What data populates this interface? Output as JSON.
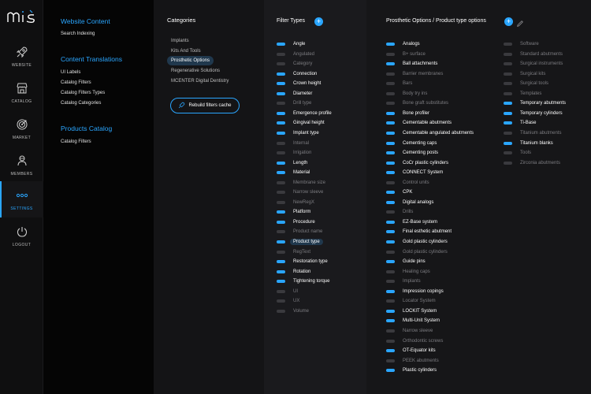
{
  "app": {
    "logo_text": "MIS"
  },
  "nav": [
    {
      "key": "website",
      "label": "WEBSITE",
      "icon": "rocket-icon",
      "active": false
    },
    {
      "key": "catalog",
      "label": "CATALOG",
      "icon": "store-icon",
      "active": false
    },
    {
      "key": "market",
      "label": "MARKET",
      "icon": "target-icon",
      "active": false
    },
    {
      "key": "members",
      "label": "MEMBERS",
      "icon": "members-icon",
      "active": false
    },
    {
      "key": "settings",
      "label": "SETTINGS",
      "icon": "dots-icon",
      "active": true
    },
    {
      "key": "logout",
      "label": "LOGOUT",
      "icon": "power-icon",
      "active": false
    }
  ],
  "content_menu": {
    "website_content": {
      "title": "Website Content",
      "items": [
        "Search Indexing"
      ]
    },
    "content_translations": {
      "title": "Content Translations",
      "items": [
        "UI Labels",
        "Catalog Filters",
        "Catalog Filters Types",
        "Catalog Categories"
      ]
    },
    "products_catalog": {
      "title": "Products Catalog",
      "items": [
        "Catalog Filters"
      ]
    }
  },
  "categories": {
    "title": "Categories",
    "items": [
      "Implants",
      "Kits And Tools",
      "Prosthetic Options",
      "Regenerative Solutions",
      "MCENTER Digital Dentistry"
    ],
    "active_index": 2,
    "rebuild_button": "Rebuild filters cache"
  },
  "filter_types": {
    "title": "Filter Types",
    "items": [
      {
        "label": "Angle",
        "on": true
      },
      {
        "label": "Angulated",
        "on": false
      },
      {
        "label": "Category",
        "on": false
      },
      {
        "label": "Connection",
        "on": true
      },
      {
        "label": "Crown height",
        "on": true
      },
      {
        "label": "Diameter",
        "on": true
      },
      {
        "label": "Drill type",
        "on": false
      },
      {
        "label": "Emergence profile",
        "on": true
      },
      {
        "label": "Gingival height",
        "on": true
      },
      {
        "label": "Implant type",
        "on": true
      },
      {
        "label": "Internal",
        "on": false
      },
      {
        "label": "Irrigation",
        "on": false
      },
      {
        "label": "Length",
        "on": true
      },
      {
        "label": "Material",
        "on": true
      },
      {
        "label": "Membrane size",
        "on": false
      },
      {
        "label": "Narrow sleeve",
        "on": false
      },
      {
        "label": "NewRegX",
        "on": false
      },
      {
        "label": "Platform",
        "on": true
      },
      {
        "label": "Procedure",
        "on": true
      },
      {
        "label": "Product name",
        "on": false
      },
      {
        "label": "Product type",
        "on": true,
        "selected": true
      },
      {
        "label": "RegText",
        "on": false
      },
      {
        "label": "Restoration type",
        "on": true
      },
      {
        "label": "Rotation",
        "on": true
      },
      {
        "label": "Tightening torque",
        "on": true
      },
      {
        "label": "UI",
        "on": false
      },
      {
        "label": "UX",
        "on": false
      },
      {
        "label": "Volume",
        "on": false
      }
    ]
  },
  "product_options": {
    "title": "Prosthetic Options / Product type options",
    "col1": [
      {
        "label": "Analogs",
        "on": true
      },
      {
        "label": "B+ surface",
        "on": false
      },
      {
        "label": "Ball attachments",
        "on": true
      },
      {
        "label": "Barrier membranes",
        "on": false
      },
      {
        "label": "Bars",
        "on": false
      },
      {
        "label": "Body try ins",
        "on": false
      },
      {
        "label": "Bone graft substitutes",
        "on": false
      },
      {
        "label": "Bone profiler",
        "on": true
      },
      {
        "label": "Cementable abutments",
        "on": true
      },
      {
        "label": "Cementable angulated abutments",
        "on": true
      },
      {
        "label": "Cementing caps",
        "on": true
      },
      {
        "label": "Cementing posts",
        "on": true
      },
      {
        "label": "CoCr plastic cylinders",
        "on": true
      },
      {
        "label": "CONNECT System",
        "on": true
      },
      {
        "label": "Control units",
        "on": false
      },
      {
        "label": "CPK",
        "on": true
      },
      {
        "label": "Digital analogs",
        "on": true
      },
      {
        "label": "Drills",
        "on": false
      },
      {
        "label": "EZ-Base system",
        "on": true
      },
      {
        "label": "Final esthetic abutment",
        "on": true
      },
      {
        "label": "Gold plastic cylinders",
        "on": true
      },
      {
        "label": "Gold plastic cylinders",
        "on": false
      },
      {
        "label": "Guide pins",
        "on": true
      },
      {
        "label": "Healing caps",
        "on": false
      },
      {
        "label": "Implants",
        "on": false
      },
      {
        "label": "Impression copings",
        "on": true
      },
      {
        "label": "Locator System",
        "on": false
      },
      {
        "label": "LOCKIT System",
        "on": true
      },
      {
        "label": "Multi-Unit System",
        "on": true
      },
      {
        "label": "Narrow sleeve",
        "on": false
      },
      {
        "label": "Orthodontic screws",
        "on": false
      },
      {
        "label": "OT-Equator kits",
        "on": true
      },
      {
        "label": "PEEK abutments",
        "on": false
      },
      {
        "label": "Plastic cylinders",
        "on": true
      }
    ],
    "col2": [
      {
        "label": "Software",
        "on": false
      },
      {
        "label": "Standard abutments",
        "on": false
      },
      {
        "label": "Surgical instruments",
        "on": false
      },
      {
        "label": "Surgical kits",
        "on": false
      },
      {
        "label": "Surgical tools",
        "on": false
      },
      {
        "label": "Templates",
        "on": false
      },
      {
        "label": "Temporary abutments",
        "on": true
      },
      {
        "label": "Temporary cylinders",
        "on": true
      },
      {
        "label": "Ti-Base",
        "on": true
      },
      {
        "label": "Titanium abutments",
        "on": false
      },
      {
        "label": "Titanium blanks",
        "on": true
      },
      {
        "label": "Tools",
        "on": false
      },
      {
        "label": "Zirconia abutments",
        "on": false
      }
    ]
  },
  "colors": {
    "accent": "#2aa6ff",
    "bg": "#0b0b0c"
  }
}
